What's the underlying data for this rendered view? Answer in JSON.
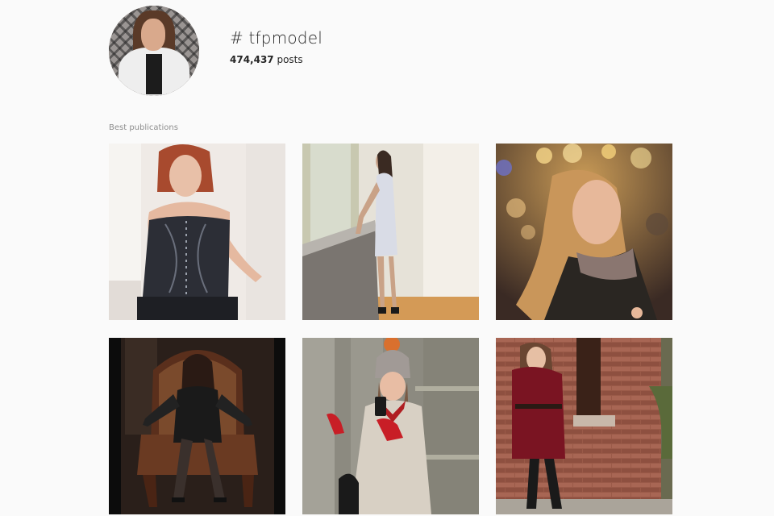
{
  "hashtag": {
    "title": "# tfpmodel",
    "post_count": "474,437",
    "post_suffix": " posts"
  },
  "section": {
    "label": "Best publications"
  },
  "posts": [
    {
      "name": "post-corset-model"
    },
    {
      "name": "post-white-dress-model"
    },
    {
      "name": "post-bokeh-portrait"
    },
    {
      "name": "post-armchair-model"
    },
    {
      "name": "post-elevator-selfie"
    },
    {
      "name": "post-brick-wall-model"
    }
  ]
}
